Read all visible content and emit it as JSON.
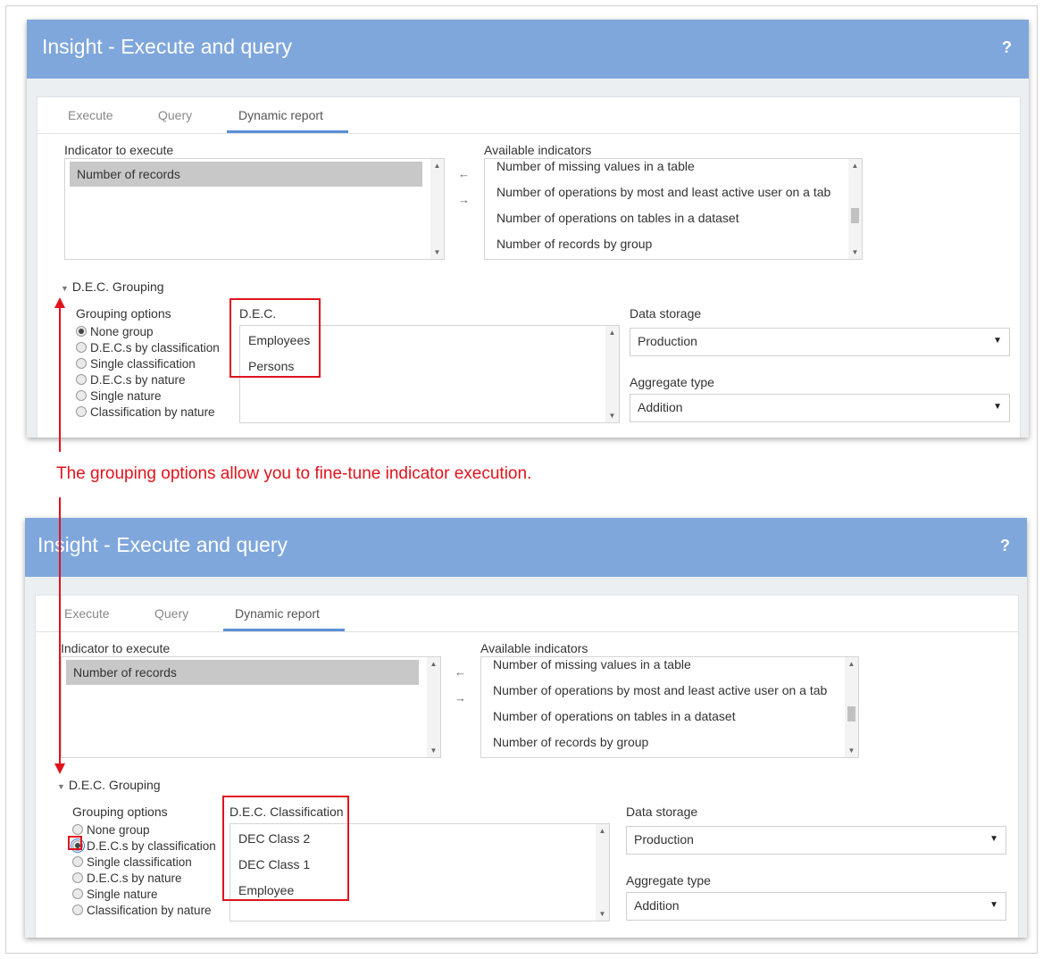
{
  "caption": "The grouping options allow you to fine-tune indicator execution.",
  "colors": {
    "header": "#7fa7dc",
    "annotation": "#e0131d",
    "tab_accent": "#5a8fd6"
  },
  "screens": [
    {
      "app_title": "Insight - Execute and query",
      "help_icon": "?",
      "tabs": [
        "Execute",
        "Query",
        "Dynamic report"
      ],
      "indicator_label": "Indicator to execute",
      "indicator_selected": "Number of records",
      "available_label": "Available indicators",
      "available_items": [
        "Number of missing values in a table",
        "Number of operations by most and least active user on a tab",
        "Number of operations on tables in a dataset",
        "Number of records by group"
      ],
      "grouping_section": "D.E.C. Grouping",
      "grouping_options_label": "Grouping options",
      "options": [
        "None group",
        "D.E.C.s by classification",
        "Single classification",
        "D.E.C.s by nature",
        "Single nature",
        "Classification by nature"
      ],
      "selected_option": "None group",
      "dec_label": "D.E.C.",
      "dec_items": [
        "Employees",
        "Persons"
      ],
      "data_storage_label": "Data storage",
      "data_storage_value": "Production",
      "aggregate_label": "Aggregate type",
      "aggregate_value": "Addition"
    },
    {
      "app_title": "Insight - Execute and query",
      "help_icon": "?",
      "tabs": [
        "Execute",
        "Query",
        "Dynamic report"
      ],
      "indicator_label": "Indicator to execute",
      "indicator_selected": "Number of records",
      "available_label": "Available indicators",
      "available_items": [
        "Number of missing values in a table",
        "Number of operations by most and least active user on a tab",
        "Number of operations on tables in a dataset",
        "Number of records by group"
      ],
      "grouping_section": "D.E.C. Grouping",
      "grouping_options_label": "Grouping options",
      "options": [
        "None group",
        "D.E.C.s by classification",
        "Single classification",
        "D.E.C.s by nature",
        "Single nature",
        "Classification by nature"
      ],
      "selected_option": "D.E.C.s by classification",
      "dec_label": "D.E.C. Classification",
      "dec_items": [
        "DEC Class 2",
        "DEC Class 1",
        "Employee"
      ],
      "data_storage_label": "Data storage",
      "data_storage_value": "Production",
      "aggregate_label": "Aggregate type",
      "aggregate_value": "Addition"
    }
  ]
}
